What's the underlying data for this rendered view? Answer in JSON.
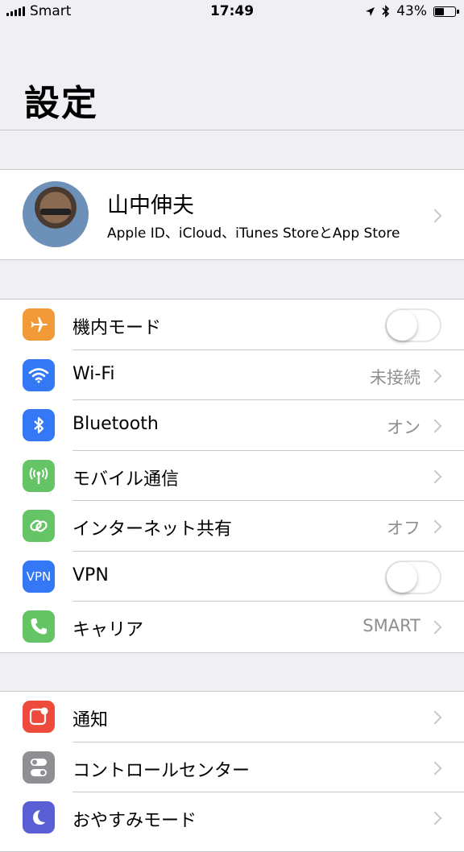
{
  "status_bar": {
    "carrier": "Smart",
    "time": "17:49",
    "battery": "43%",
    "battery_level": 0.43,
    "icons": [
      "signal-icon",
      "location-arrow-icon",
      "bluetooth-icon",
      "battery-icon"
    ]
  },
  "page": {
    "title": "設定"
  },
  "profile": {
    "name": "山中伸夫",
    "subtitle": "Apple ID、iCloud、iTunes StoreとApp Store"
  },
  "section1": [
    {
      "label": "機内モード",
      "icon": "airplane-icon",
      "color": "#f19a37",
      "toggle": true,
      "on": false
    },
    {
      "label": "Wi-Fi",
      "icon": "wifi-icon",
      "color": "#3478f6",
      "value": "未接続"
    },
    {
      "label": "Bluetooth",
      "icon": "bluetooth-icon",
      "color": "#3478f6",
      "value": "オン"
    },
    {
      "label": "モバイル通信",
      "icon": "antenna-icon",
      "color": "#65c466"
    },
    {
      "label": "インターネット共有",
      "icon": "link-icon",
      "color": "#65c466",
      "value": "オフ"
    },
    {
      "label": "VPN",
      "icon": "vpn-icon",
      "icon_text": "VPN",
      "color": "#3478f6",
      "toggle": true,
      "on": false
    },
    {
      "label": "キャリア",
      "icon": "phone-icon",
      "color": "#65c466",
      "value": "SMART"
    }
  ],
  "section2": [
    {
      "label": "通知",
      "icon": "notification-icon",
      "color": "#ee4b3c"
    },
    {
      "label": "コントロールセンター",
      "icon": "control-center-icon",
      "color": "#8e8e93"
    },
    {
      "label": "おやすみモード",
      "icon": "moon-icon",
      "color": "#5b5fd6"
    }
  ]
}
